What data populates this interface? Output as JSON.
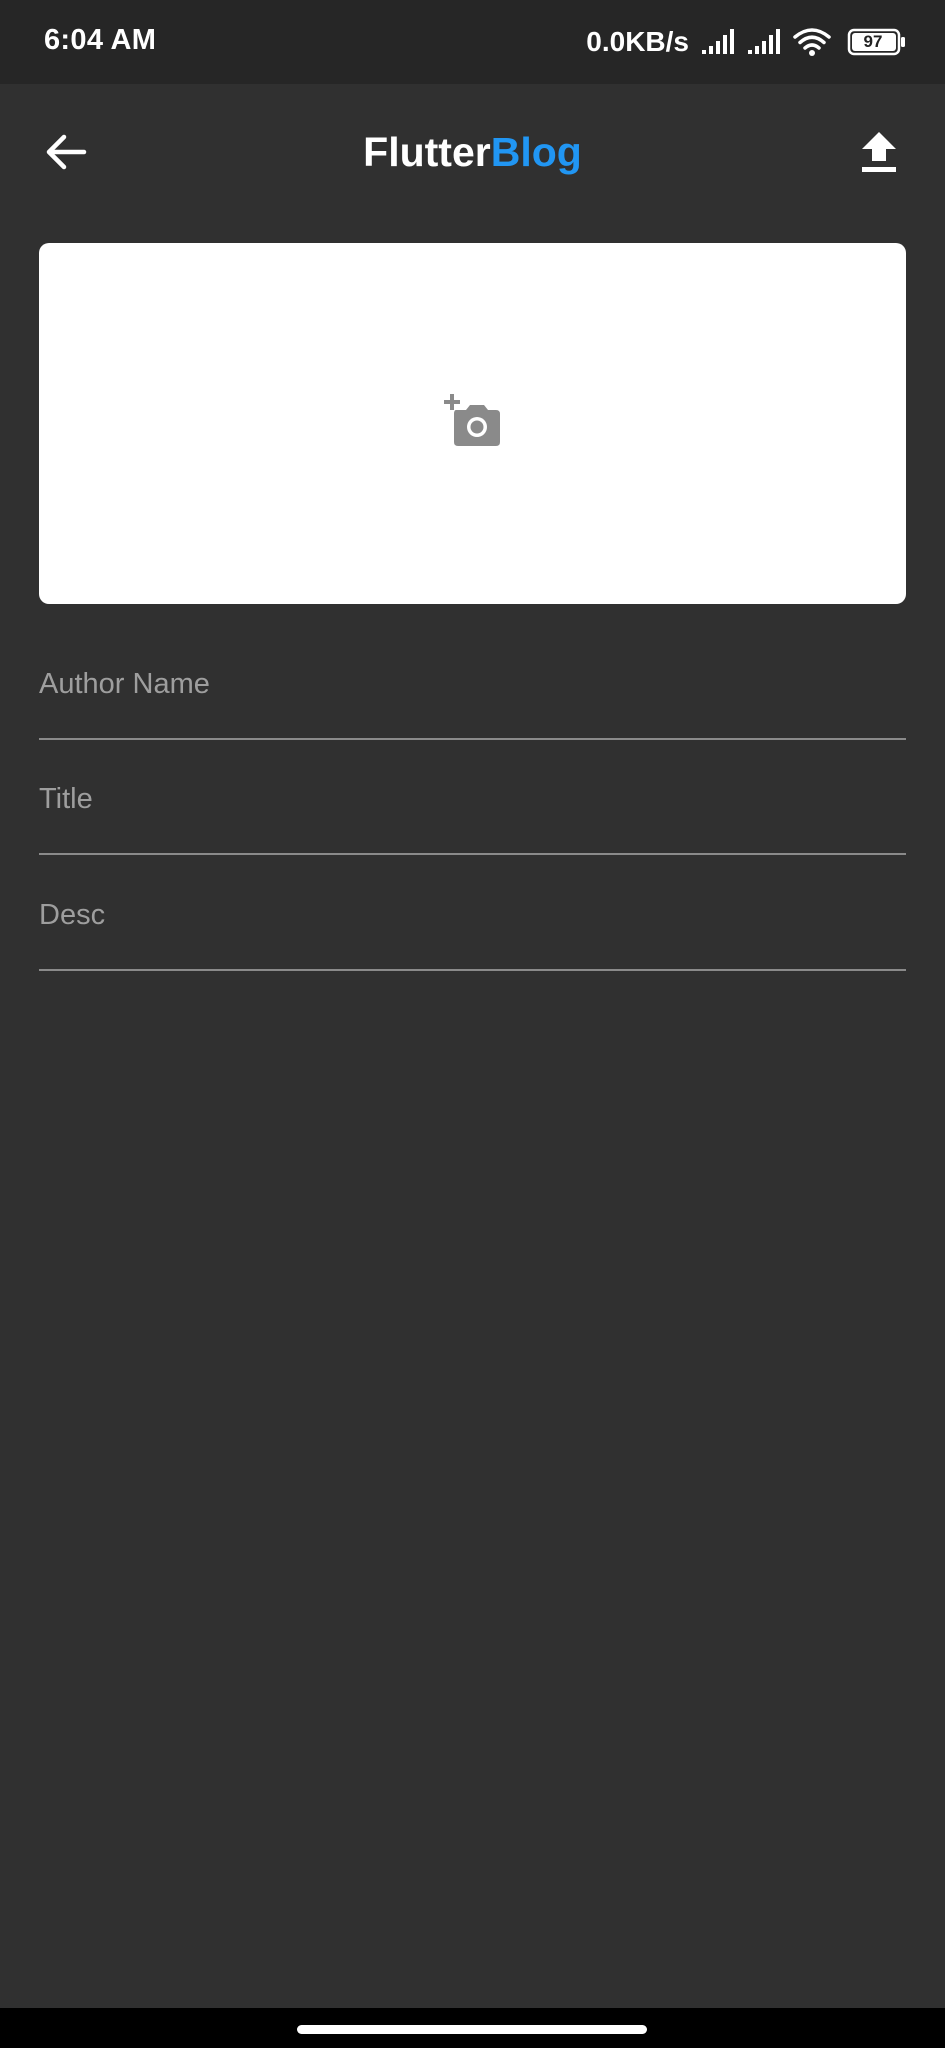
{
  "status_bar": {
    "time": "6:04 AM",
    "net_speed": "0.0KB/s",
    "battery_level": "97",
    "icons": [
      "signal-icon",
      "signal-icon",
      "wifi-icon",
      "battery-icon"
    ]
  },
  "app_bar": {
    "title_part_1": "Flutter",
    "title_part_2": "Blog",
    "back_icon": "arrow-back-icon",
    "upload_icon": "upload-icon"
  },
  "image_picker": {
    "icon": "add-a-photo-icon"
  },
  "form": {
    "author": {
      "placeholder": "Author Name",
      "value": ""
    },
    "title": {
      "placeholder": "Title",
      "value": ""
    },
    "desc": {
      "placeholder": "Desc",
      "value": ""
    }
  },
  "colors": {
    "background": "#303030",
    "status_bar": "#262626",
    "accent": "#2196f3",
    "card": "#ffffff",
    "icon_gray": "#8a8a8a",
    "placeholder": "#9e9e9e"
  }
}
